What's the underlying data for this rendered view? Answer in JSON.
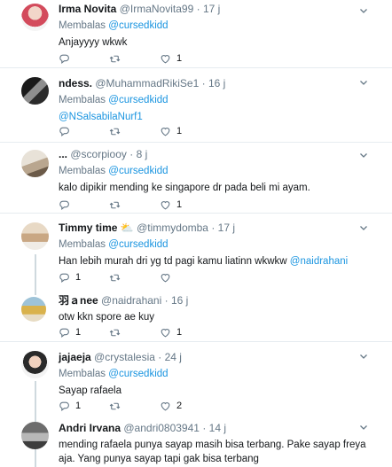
{
  "tweets": [
    {
      "name": "Irma Novita",
      "handle": "@IrmaNovita99",
      "dot": "·",
      "time": "17 j",
      "reply_prefix": "Membalas",
      "reply_to": "@cursedkidd",
      "text": "Anjayyyy wkwk",
      "replies": "",
      "retweets": "",
      "likes": "1"
    },
    {
      "name": "ndess.",
      "handle": "@MuhammadRikiSe1",
      "dot": "·",
      "time": "16 j",
      "reply_prefix": "Membalas",
      "reply_to": "@cursedkidd",
      "text_mention": "@NSalsabilaNurf1",
      "replies": "",
      "retweets": "",
      "likes": "1"
    },
    {
      "name": "...",
      "handle": "@scorpiooy",
      "dot": "·",
      "time": "8 j",
      "reply_prefix": "Membalas",
      "reply_to": "@cursedkidd",
      "text": "kalo dipikir mending ke singapore dr pada beli mi ayam.",
      "replies": "",
      "retweets": "",
      "likes": "1"
    },
    {
      "name": "Timmy time",
      "emoji": "⛅",
      "handle": "@timmydomba",
      "dot": "·",
      "time": "17 j",
      "reply_prefix": "Membalas",
      "reply_to": "@cursedkidd",
      "text": "Han lebih murah dri yg td pagi kamu liatinn wkwkw ",
      "text_mention": "@naidrahani",
      "replies": "1",
      "retweets": "",
      "likes": ""
    },
    {
      "name": "羽ａnee",
      "handle": "@naidrahani",
      "dot": "·",
      "time": "16 j",
      "text": "otw kkn spore ae kuy",
      "replies": "1",
      "retweets": "",
      "likes": "1"
    },
    {
      "name": "jajaeja",
      "handle": "@crystalesia",
      "dot": "·",
      "time": "24 j",
      "reply_prefix": "Membalas",
      "reply_to": "@cursedkidd",
      "text": "Sayap rafaela",
      "replies": "1",
      "retweets": "",
      "likes": "2"
    },
    {
      "name": "Andri Irvana",
      "handle": "@andri0803941",
      "dot": "·",
      "time": "14 j",
      "text": "mending rafaela punya sayap masih bisa terbang. Pake sayap freya aja. Yang punya sayap tapi gak bisa terbang"
    }
  ],
  "colors": {
    "accent": "#1b95e0",
    "muted": "#657786",
    "divider": "#e6ecf0"
  },
  "icons": [
    "reply-icon",
    "retweet-icon",
    "like-icon",
    "chevron-down-icon"
  ]
}
